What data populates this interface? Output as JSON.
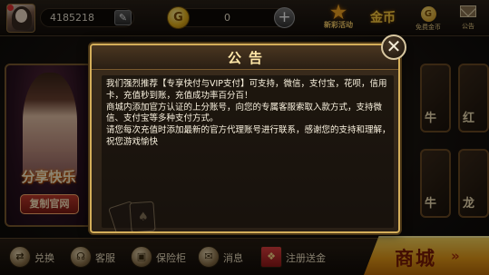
{
  "header": {
    "user_id": "4185218",
    "coins": "0",
    "icons": {
      "event_label": "新彩活动",
      "hall_label": "金币",
      "free_coin_label": "免费金币",
      "free_coin_glyph": "G",
      "notice_label": "公告"
    },
    "coin_glyph": "G"
  },
  "background": {
    "promo": {
      "share_text": "分享快乐",
      "copy_button": "复制官网"
    },
    "tiles": [
      "牛",
      "红",
      "牛",
      "龙"
    ]
  },
  "dialog": {
    "title": "公告",
    "paragraphs": [
      "我们强烈推荐【专享快付与VIP支付】可支持，微信，支付宝，花呗，信用卡，充值秒到账，充值成功率百分百！",
      "商城内添加官方认证的上分账号，向您的专属客服索取入款方式，支持微信、支付宝等多种支付方式。",
      "请您每次充值时添加最新的官方代理账号进行联系，感谢您的支持和理解，祝您游戏愉快"
    ],
    "close_glyph": "✕"
  },
  "bottom_nav": {
    "exchange": "兑换",
    "service": "客服",
    "safe": "保险柜",
    "messages": "消息",
    "register": "注册送金",
    "shop": "商城",
    "shop_arrows": "»"
  }
}
